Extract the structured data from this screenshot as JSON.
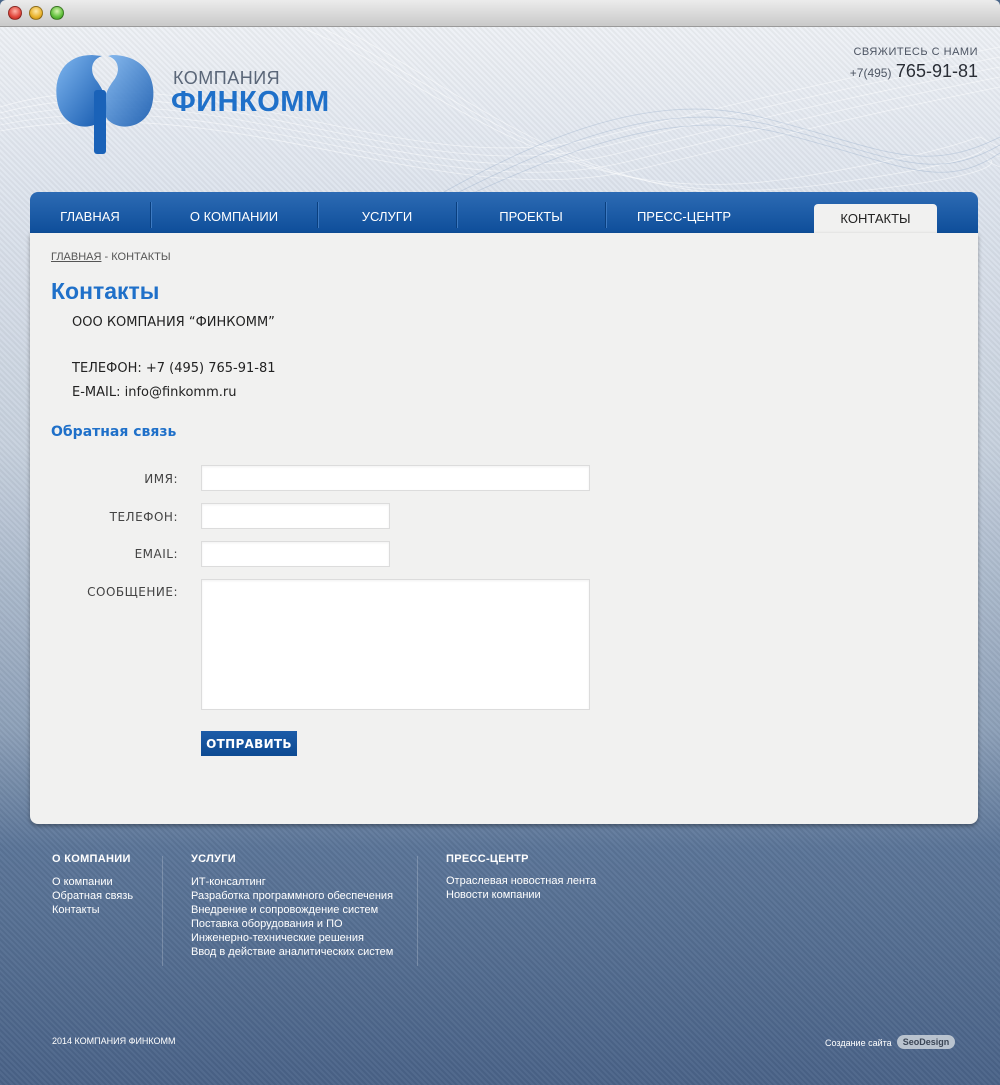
{
  "header": {
    "logo_small": "КОМПАНИЯ",
    "logo_big": "ФИНКОММ",
    "contact_label": "СВЯЖИТЕСЬ С НАМИ",
    "phone_code": "+7(495)",
    "phone_number": "765-91-81"
  },
  "nav": {
    "items": [
      {
        "label": "ГЛАВНАЯ"
      },
      {
        "label": "О КОМПАНИИ"
      },
      {
        "label": "УСЛУГИ"
      },
      {
        "label": "ПРОЕКТЫ"
      },
      {
        "label": "ПРЕСС-ЦЕНТР"
      },
      {
        "label": "КОНТАКТЫ",
        "active": true
      }
    ]
  },
  "breadcrumb": {
    "home": "ГЛАВНАЯ",
    "separator": " - ",
    "current": "КОНТАКТЫ"
  },
  "page_title": "Контакты",
  "info": {
    "company": "ООО КОМПАНИЯ “ФИНКОММ”",
    "phone": "ТЕЛЕФОН: +7 (495) 765-91-81",
    "email": "E-MAIL: info@finkomm.ru"
  },
  "feedback": {
    "title": "Обратная связь",
    "name_label": "ИМЯ:",
    "name_value": "",
    "phone_label": "ТЕЛЕФОН:",
    "phone_value": "",
    "email_label": "EMAIL:",
    "email_value": "",
    "message_label": "СООБЩЕНИЕ:",
    "message_value": "",
    "submit_label": "ОТПРАВИТЬ"
  },
  "footer": {
    "col1": {
      "title": "О КОМПАНИИ",
      "links": [
        "О компании",
        "Обратная связь",
        "Контакты"
      ]
    },
    "col2": {
      "title": "УСЛУГИ",
      "links": [
        "ИТ-консалтинг",
        "Разработка программного обеспечения",
        "Внедрение и сопровождение систем",
        "Поставка оборудования и ПО",
        "Инженерно-технические решения",
        "Ввод в действие аналитических систем"
      ]
    },
    "col3": {
      "title": "ПРЕСС-ЦЕНТР",
      "links": [
        "Отраслевая новостная лента",
        "Новости компании"
      ]
    },
    "copyright": "2014 КОМПАНИЯ ФИНКОММ",
    "made_by": "Создание сайта",
    "made_badge": "SeoDesign"
  },
  "colors": {
    "accent": "#1f70c9",
    "nav": "#0e4e9a",
    "panel": "#f1f1f0",
    "footer_bg": "#4a6388"
  }
}
